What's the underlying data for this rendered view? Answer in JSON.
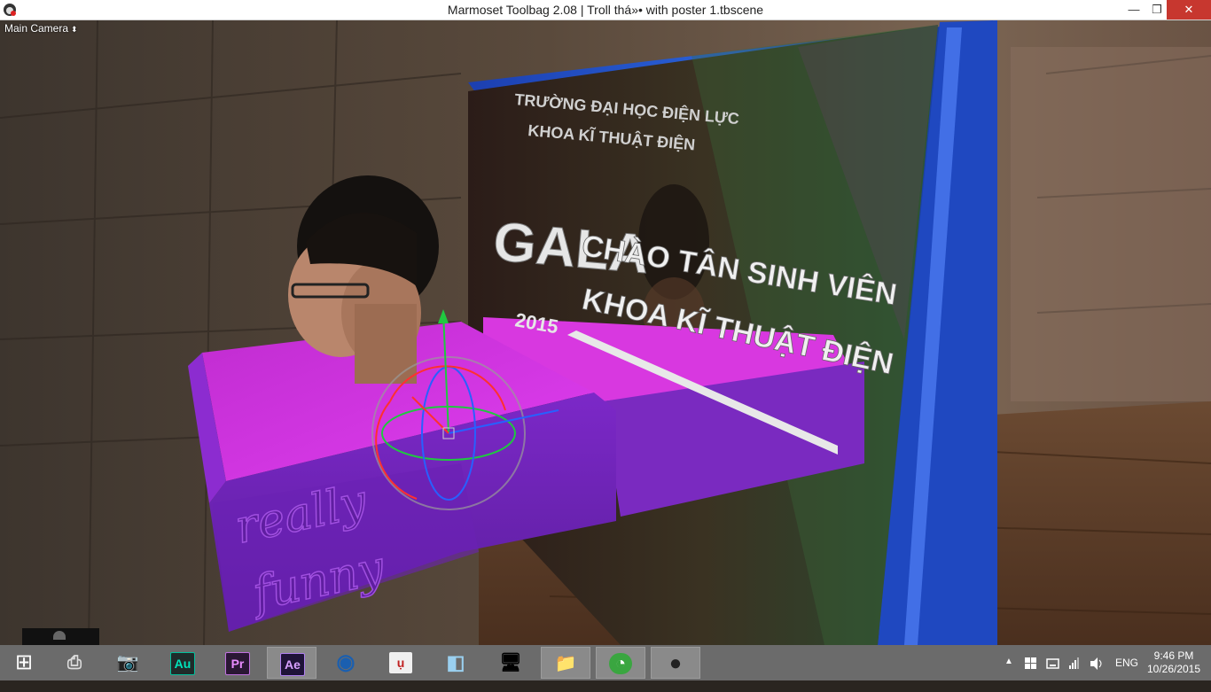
{
  "window": {
    "title": "Marmoset Toolbag 2.08  |  Troll thá»• with poster 1.tbscene",
    "minimize_glyph": "—",
    "maximize_glyph": "❐",
    "close_glyph": "✕"
  },
  "viewport": {
    "camera_label": "Main Camera",
    "camera_arrows": "⬍"
  },
  "scene_text": {
    "poster_line1": "TRƯỜNG ĐẠI HỌC ĐIỆN LỰC",
    "poster_line2": "KHOA KĨ THUẬT ĐIỆN",
    "gala": "GALA",
    "headline1": "CHÀO TÂN SINH VIÊN",
    "headline2": "KHOA KĨ THUẬT ĐIỆN",
    "year": "2015",
    "box_text1": "really",
    "box_text2": "funny"
  },
  "taskbar": {
    "items": [
      {
        "name": "windows-start",
        "glyph": "⊞",
        "color": "#ffffff",
        "bg": "transparent"
      },
      {
        "name": "scanner-app",
        "glyph": "⎙",
        "color": "#dddddd",
        "bg": "transparent"
      },
      {
        "name": "camera-app",
        "glyph": "📷",
        "color": "#222222",
        "bg": "transparent"
      },
      {
        "name": "audition-app",
        "glyph": "Au",
        "color": "#00e4bb",
        "bg": "#1f2b2a"
      },
      {
        "name": "premiere-app",
        "glyph": "Pr",
        "color": "#e98cff",
        "bg": "#2a1734"
      },
      {
        "name": "after-effects-app",
        "glyph": "Ae",
        "color": "#d8a1ff",
        "bg": "#1f1338"
      },
      {
        "name": "cinema4d-app",
        "glyph": "◉",
        "color": "#1a5fb0",
        "bg": "transparent"
      },
      {
        "name": "unikey-app",
        "glyph": "ụ",
        "color": "#c02020",
        "bg": "#f0f0f0"
      },
      {
        "name": "notes-app",
        "glyph": "◧",
        "color": "#9ad0f0",
        "bg": "transparent"
      },
      {
        "name": "remote-desktop-app",
        "glyph": "🖥",
        "color": "#d0e4ff",
        "bg": "transparent"
      },
      {
        "name": "file-explorer-app",
        "glyph": "📁",
        "color": "#f0c040",
        "bg": "transparent"
      },
      {
        "name": "coccoc-app",
        "glyph": "◔",
        "color": "#ffffff",
        "bg": "#3aa640"
      },
      {
        "name": "marmoset-app",
        "glyph": "●",
        "color": "#222222",
        "bg": "transparent"
      }
    ],
    "tray": {
      "up_arrow": "▲",
      "language": "ENG",
      "time": "9:46 PM",
      "date": "10/26/2015"
    }
  }
}
